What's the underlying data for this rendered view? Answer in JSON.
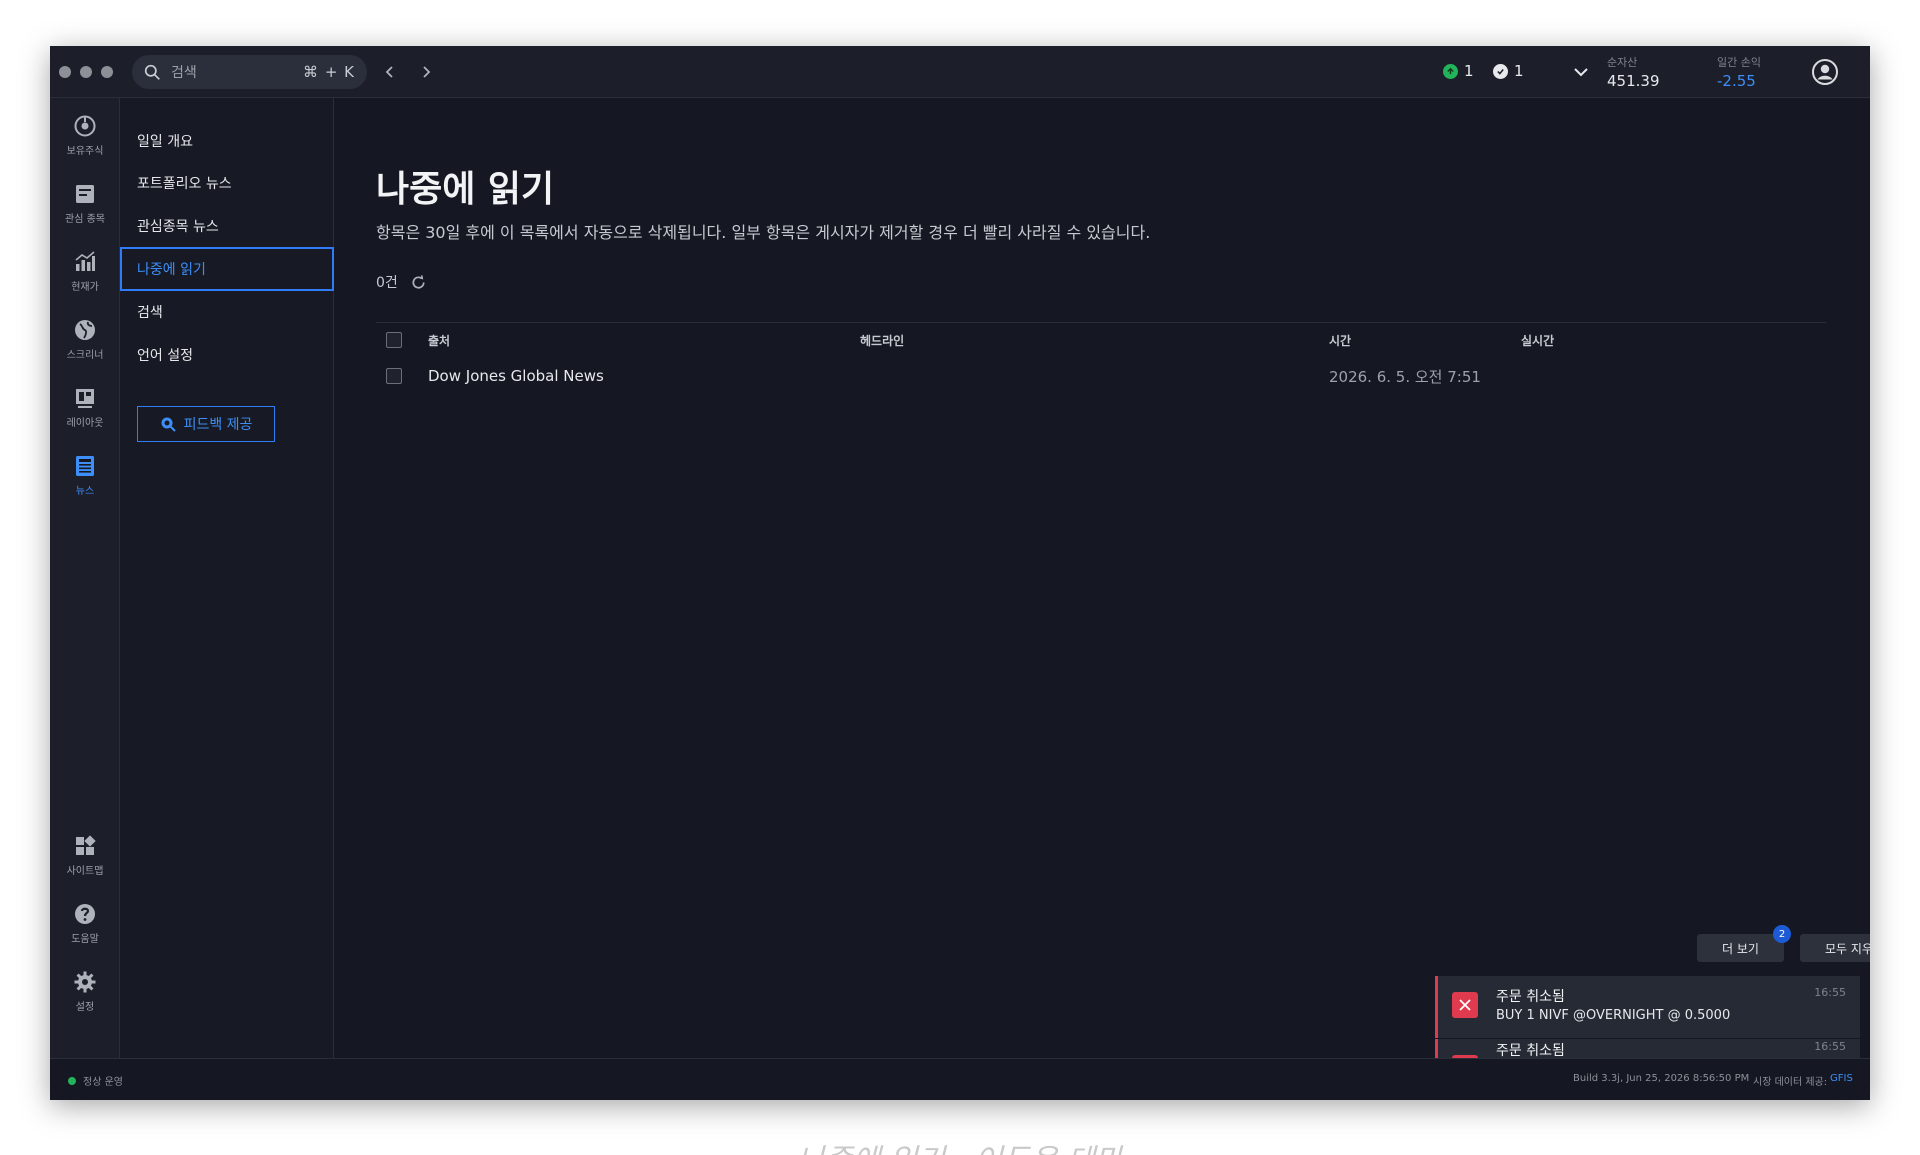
{
  "titlebar": {
    "search": {
      "placeholder": "검색",
      "shortcut": "⌘ + K"
    },
    "status_a": {
      "count": "1",
      "color": "#23b35a"
    },
    "status_b": {
      "count": "1"
    },
    "net_liq": {
      "label": "순자산",
      "value": "451.39"
    },
    "daily_pnl": {
      "label": "일간 손익",
      "value": "-2.55",
      "color": "#3e8ef7"
    }
  },
  "rail": {
    "items": [
      {
        "label": "보유주식",
        "icon": "portfolio-icon"
      },
      {
        "label": "관심 종목",
        "icon": "watchlist-icon"
      },
      {
        "label": "현재가",
        "icon": "quote-chart-icon"
      },
      {
        "label": "스크리너",
        "icon": "globe-icon"
      },
      {
        "label": "레이아웃",
        "icon": "layout-icon"
      },
      {
        "label": "뉴스",
        "icon": "news-icon",
        "active": true
      }
    ],
    "bottom": [
      {
        "label": "사이트맵",
        "icon": "sitemap-icon"
      },
      {
        "label": "도움말",
        "icon": "help-icon"
      },
      {
        "label": "설정",
        "icon": "gear-icon"
      }
    ]
  },
  "subnav": {
    "items": [
      "일일 개요",
      "포트폴리오 뉴스",
      "관심종목 뉴스",
      "나중에 읽기",
      "검색",
      "언어 설정"
    ],
    "active": "나중에 읽기",
    "feedback_label": "피드백 제공"
  },
  "main": {
    "title": "나중에 읽기",
    "notice": "항목은 30일 후에 이 목록에서 자동으로 삭제됩니다. 일부 항목은 게시자가 제거할 경우 더 빨리 사라질 수 있습니다.",
    "count": "0건",
    "table": {
      "columns": [
        "출처",
        "헤드라인",
        "시간",
        "실시간"
      ],
      "rows": [
        {
          "source": "Dow Jones Global News",
          "headline": "",
          "time": "2026. 6. 5. 오전 7:51",
          "realtime": ""
        }
      ]
    }
  },
  "notifications": {
    "more_label": "더 보기",
    "more_badge": "2",
    "clear_label": "모두 지우기",
    "items": [
      {
        "title": "주문 취소됨",
        "body": "BUY 1 NIVF @OVERNIGHT @ 0.5000",
        "time": "16:55"
      },
      {
        "title": "주문 취소됨",
        "body": "",
        "time": "16:55"
      }
    ],
    "accent": "#e03a4e"
  },
  "statusbar": {
    "state": "정상 운영",
    "build": "Build 3.3j, Jun 25, 2026 8:56:50 PM",
    "provider_label": "시장 데이터 제공:",
    "provider_name": "GFIS"
  },
  "caption": "나중에 읽기 - 어두운 테마"
}
